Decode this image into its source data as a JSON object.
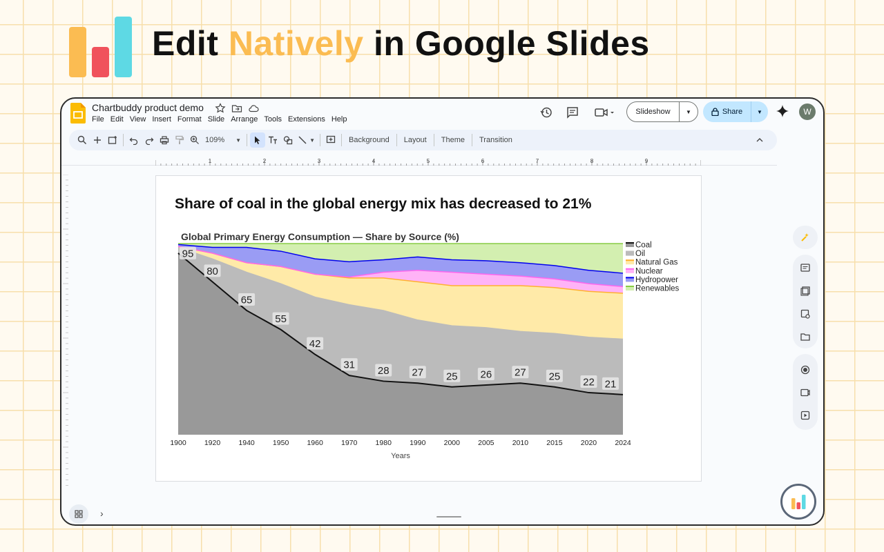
{
  "hero": {
    "title_prefix": "Edit ",
    "title_accent": "Natively",
    "title_suffix": " in Google Slides",
    "accent_color": "#fbbc52",
    "logo_colors": [
      "#fbbc52",
      "#f0525c",
      "#5ed9e4"
    ]
  },
  "app": {
    "doc_title": "Chartbuddy product demo",
    "menu": [
      "File",
      "Edit",
      "View",
      "Insert",
      "Format",
      "Slide",
      "Arrange",
      "Tools",
      "Extensions",
      "Help"
    ],
    "slideshow_label": "Slideshow",
    "share_label": "Share",
    "avatar_initial": "W",
    "toolbar": {
      "zoom": "109%",
      "background": "Background",
      "layout": "Layout",
      "theme": "Theme",
      "transition": "Transition"
    },
    "ruler_numbers": [
      "1",
      "2",
      "3",
      "4",
      "5",
      "6",
      "7",
      "8",
      "9"
    ]
  },
  "slide": {
    "heading": "Share of coal in the global energy mix has decreased to 21%"
  },
  "chart_data": {
    "type": "area",
    "title": "Global Primary Energy Consumption — Share by Source (%)",
    "xlabel": "Years",
    "ylabel": "",
    "stacked": true,
    "ylim": [
      0,
      100
    ],
    "x": [
      "1900",
      "1920",
      "1940",
      "1950",
      "1960",
      "1970",
      "1980",
      "1990",
      "2000",
      "2005",
      "2010",
      "2015",
      "2020",
      "2024"
    ],
    "legend_position": "right",
    "series": [
      {
        "name": "Coal",
        "color": "#999999",
        "line": "#111111",
        "values": [
          95,
          80,
          65,
          55,
          42,
          31,
          28,
          27,
          25,
          26,
          27,
          25,
          22,
          21
        ]
      },
      {
        "name": "Oil",
        "color": "#bbbbbb",
        "line": "#bbbbbb",
        "values": [
          3,
          12,
          20,
          24,
          30,
          37,
          37,
          33,
          32,
          30,
          27,
          28,
          29,
          29
        ]
      },
      {
        "name": "Natural Gas",
        "color": "#ffeaa8",
        "line": "#ffb030",
        "values": [
          0.5,
          3,
          5,
          9,
          12,
          14,
          17,
          20,
          21,
          22,
          24,
          24,
          24,
          24
        ]
      },
      {
        "name": "Nuclear",
        "color": "#ffb3f7",
        "line": "#ff66ee",
        "values": [
          0,
          0,
          0,
          0,
          0,
          0.5,
          3,
          6,
          7,
          6,
          5,
          4.5,
          4,
          3.5
        ]
      },
      {
        "name": "Hydropower",
        "color": "#9a9cf4",
        "line": "#0000ee",
        "values": [
          1,
          3,
          8,
          8,
          8,
          8,
          6.5,
          7,
          6.5,
          7,
          7,
          7,
          7,
          7
        ]
      },
      {
        "name": "Renewables",
        "color": "#d3efb0",
        "line": "#88cc44",
        "values": [
          0.5,
          2,
          2,
          4,
          8,
          9.5,
          8.5,
          7,
          8.5,
          9,
          10,
          11.5,
          14,
          15.5
        ]
      }
    ],
    "data_labels": [
      95,
      80,
      65,
      55,
      42,
      31,
      28,
      27,
      25,
      26,
      27,
      25,
      22,
      21
    ]
  }
}
